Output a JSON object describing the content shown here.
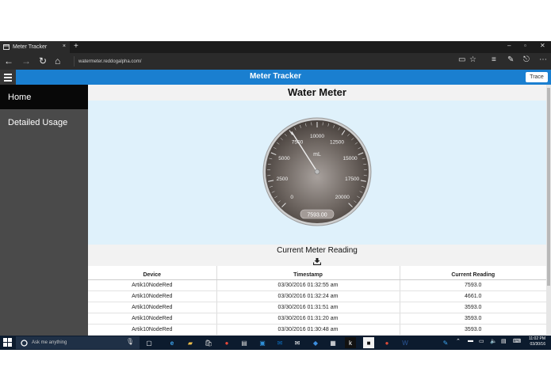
{
  "browser": {
    "tab_title": "Meter Tracker",
    "tab_close": "×",
    "new_tab": "+",
    "url": "watermeter.reddogalpha.com/"
  },
  "app": {
    "title": "Meter Tracker",
    "trace_label": "Trace"
  },
  "sidebar": {
    "items": [
      {
        "label": "Home",
        "active": true
      },
      {
        "label": "Detailed Usage",
        "active": false
      }
    ]
  },
  "main": {
    "panel_title": "Water Meter",
    "gauge": {
      "unit": "mL",
      "value": 7593.0,
      "value_text": "7593.00",
      "min": 0,
      "max": 20000,
      "ticks": [
        "0",
        "2500",
        "5000",
        "7500",
        "10000",
        "12500",
        "15000",
        "17500",
        "20000"
      ]
    },
    "reading_title": "Current Meter Reading",
    "table": {
      "headers": [
        "Device",
        "Timestamp",
        "Current Reading"
      ],
      "rows": [
        [
          "Artik10NodeRed",
          "03/30/2016 01:32:55 am",
          "7593.0"
        ],
        [
          "Artik10NodeRed",
          "03/30/2016 01:32:24 am",
          "4661.0"
        ],
        [
          "Artik10NodeRed",
          "03/30/2016 01:31:51 am",
          "3593.0"
        ],
        [
          "Artik10NodeRed",
          "03/30/2016 01:31:20 am",
          "3593.0"
        ],
        [
          "Artik10NodeRed",
          "03/30/2016 01:30:48 am",
          "3593.0"
        ]
      ]
    }
  },
  "taskbar": {
    "search_placeholder": "Ask me anything",
    "time": "11:02 PM",
    "date": "03/30/16"
  },
  "colors": {
    "header_blue": "#1a7fd0",
    "sidebar_bg": "#4a4a4a",
    "gauge_bg": "#dff1fb",
    "taskbar_bg": "#0c1b2e"
  }
}
